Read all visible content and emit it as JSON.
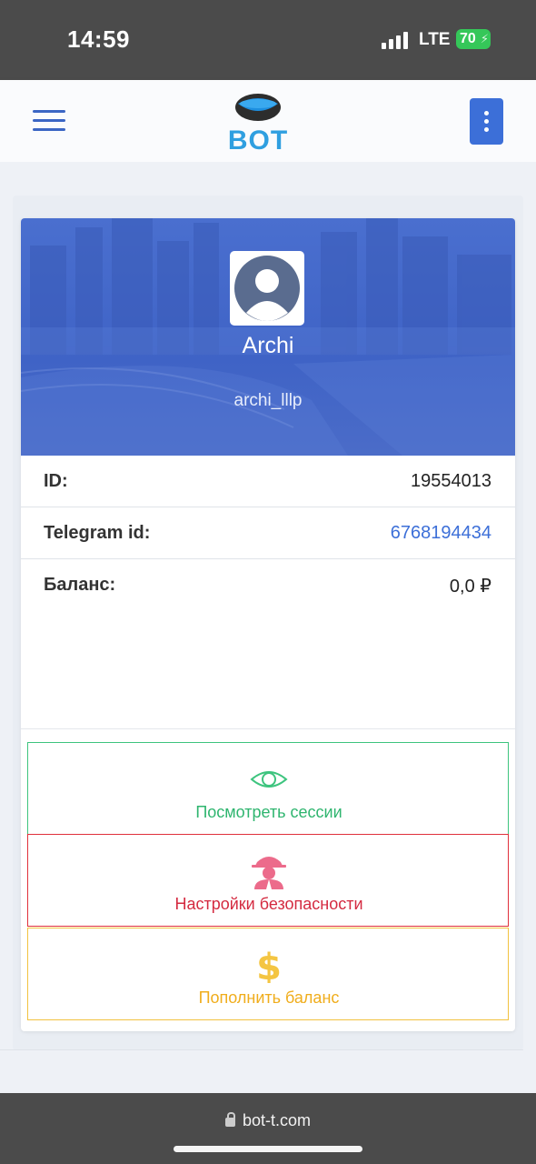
{
  "status_bar": {
    "time": "14:59",
    "network": "LTE",
    "battery": "70"
  },
  "header": {
    "logo_text": "BOT"
  },
  "profile": {
    "name": "Archi",
    "username": "archi_lllp"
  },
  "info": [
    {
      "label": "ID:",
      "value": "19554013"
    },
    {
      "label": "Telegram id:",
      "value": "6768194434"
    },
    {
      "label": "Баланс:",
      "value": "0,0 ₽"
    }
  ],
  "actions": [
    {
      "label": "Посмотреть сессии",
      "icon": "eye-icon",
      "color": "#2fb56f"
    },
    {
      "label": "Настройки безопасности",
      "icon": "spy-icon",
      "color": "#d42a40"
    },
    {
      "label": "Пополнить баланс",
      "icon": "dollar-icon",
      "color": "#f0ad1c"
    }
  ],
  "browser": {
    "url": "bot-t.com"
  },
  "colors": {
    "accent": "#3c6fd8",
    "banner": "#4a6fcf",
    "status_bar": "#4b4b4b"
  }
}
